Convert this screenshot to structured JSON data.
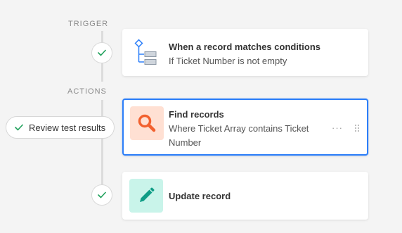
{
  "sections": {
    "trigger_label": "TRIGGER",
    "actions_label": "ACTIONS"
  },
  "trigger_card": {
    "title": "When a record matches conditions",
    "subtitle": "If Ticket Number is not empty",
    "icon": "conditions-tree-icon"
  },
  "test_pill": {
    "label": "Review test results",
    "icon": "check-icon"
  },
  "find_card": {
    "title": "Find records",
    "subtitle": "Where Ticket Array contains Ticket Number",
    "icon": "search-icon",
    "more_label": "···",
    "selected": true
  },
  "update_card": {
    "title": "Update record",
    "icon": "pencil-icon"
  },
  "colors": {
    "accent_blue": "#2d7ff9",
    "check_green": "#20a15c",
    "find_icon_bg": "#ffe0d3",
    "find_icon_fg": "#f2612f",
    "update_icon_bg": "#c9f4ea",
    "update_icon_fg": "#0f9d86"
  }
}
